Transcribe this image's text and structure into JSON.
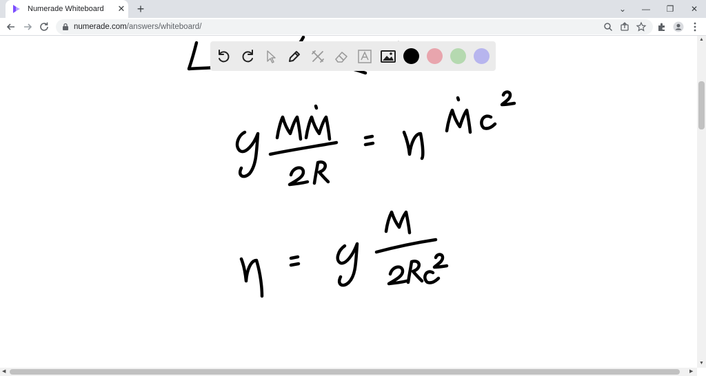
{
  "browser": {
    "tab_title": "Numerade Whiteboard",
    "tab_close": "✕",
    "new_tab": "+",
    "url_host": "numerade.com",
    "url_path": "/answers/whiteboard/",
    "window_controls": {
      "dropdown": "⌄",
      "minimize": "—",
      "restore": "❐",
      "close": "✕"
    }
  },
  "palette": {
    "tools": [
      "undo-icon",
      "redo-icon",
      "pointer-icon",
      "pen-icon",
      "tools-icon",
      "eraser-icon",
      "text-icon",
      "image-icon"
    ],
    "colors": [
      "#000000",
      "#e8a5ad",
      "#b5d9b0",
      "#b7b5ee"
    ]
  },
  "colors": {
    "accent": "#7c4dff",
    "tab_strip": "#dee1e6",
    "omnibox": "#f1f3f4",
    "palette_bg": "#ebebeb",
    "ink": "#000000"
  }
}
